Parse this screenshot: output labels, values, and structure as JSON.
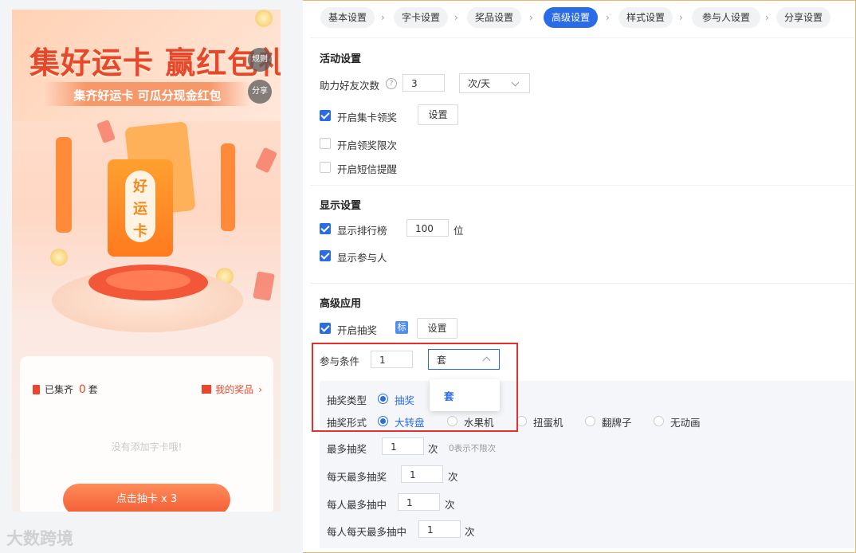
{
  "preview": {
    "title": "集好运卡 赢红包礼",
    "subtitle": "集齐好运卡 可瓜分现金红包",
    "rules_button": "规则",
    "share_button": "分享",
    "card_chars": [
      "好",
      "运",
      "卡"
    ],
    "collected_prefix": "已集齐",
    "collected_count": "0",
    "collected_unit": "套",
    "my_prizes": "我的奖品",
    "empty_text": "没有添加字卡哦!",
    "draw_button": "点击抽卡 x 3"
  },
  "watermark": "大数跨境",
  "steps": [
    "基本设置",
    "字卡设置",
    "奖品设置",
    "高级设置",
    "样式设置",
    "参与人设置",
    "分享设置"
  ],
  "active_step": "高级设置",
  "activity": {
    "title": "活动设置",
    "help_count_label": "助力好友次数",
    "help_count_value": "3",
    "help_count_unit": "次/天",
    "collect_reward_label": "开启集卡领奖",
    "collect_reward_checked": true,
    "collect_reward_button": "设置",
    "limit_label": "开启领奖限次",
    "limit_checked": false,
    "sms_label": "开启短信提醒",
    "sms_checked": false
  },
  "display": {
    "title": "显示设置",
    "ranking_label": "显示排行榜",
    "ranking_checked": true,
    "ranking_value": "100",
    "ranking_unit": "位",
    "participants_label": "显示参与人",
    "participants_checked": true
  },
  "advanced": {
    "title": "高级应用",
    "lottery_label": "开启抽奖",
    "lottery_checked": true,
    "tag": "标",
    "lottery_button": "设置",
    "condition_label": "参与条件",
    "condition_value": "1",
    "condition_unit": "套",
    "dropdown_option": "套",
    "lottery_type_label": "抽奖类型",
    "lottery_type_selected": "抽奖",
    "lottery_form_label": "抽奖形式",
    "lottery_forms": [
      "大转盘",
      "水果机",
      "扭蛋机",
      "翻牌子",
      "无动画"
    ],
    "lottery_form_selected": "大转盘",
    "max_draw_label": "最多抽奖",
    "max_draw_value": "1",
    "max_draw_unit": "次",
    "max_draw_hint": "0表示不限次",
    "daily_max_draw_label": "每天最多抽奖",
    "daily_max_draw_value": "1",
    "daily_max_draw_unit": "次",
    "person_max_win_label": "每人最多抽中",
    "person_max_win_value": "1",
    "person_max_win_unit": "次",
    "person_daily_max_win_label": "每人每天最多抽中",
    "person_daily_max_win_value": "1",
    "person_daily_max_win_unit": "次"
  },
  "colors": {
    "accent": "#2a6ce8",
    "highlight_border": "#e5312b",
    "brand_red": "#e8472b"
  }
}
